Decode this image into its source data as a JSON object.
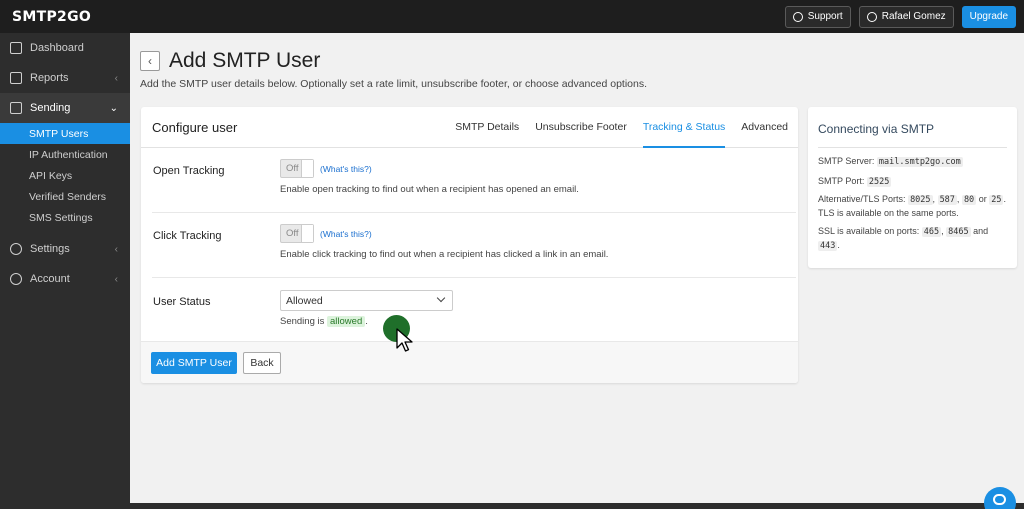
{
  "topbar": {
    "logo": "SMTP2GO",
    "support_label": "Support",
    "user_label": "Rafael Gomez",
    "upgrade_label": "Upgrade"
  },
  "sidebar": {
    "items": [
      {
        "label": "Dashboard",
        "icon": "home-icon"
      },
      {
        "label": "Reports",
        "icon": "document-icon"
      },
      {
        "label": "Sending",
        "icon": "paper-plane-icon"
      },
      {
        "label": "Settings",
        "icon": "gear-icon"
      },
      {
        "label": "Account",
        "icon": "user-circle-icon"
      }
    ],
    "sending_sub": [
      {
        "label": "SMTP Users"
      },
      {
        "label": "IP Authentication"
      },
      {
        "label": "API Keys"
      },
      {
        "label": "Verified Senders"
      },
      {
        "label": "SMS Settings"
      }
    ]
  },
  "header": {
    "title": "Add SMTP User",
    "subtitle": "Add the SMTP user details below. Optionally set a rate limit, unsubscribe footer, or choose advanced options."
  },
  "card": {
    "title": "Configure user",
    "tabs": [
      {
        "label": "SMTP Details"
      },
      {
        "label": "Unsubscribe Footer"
      },
      {
        "label": "Tracking & Status"
      },
      {
        "label": "Advanced"
      }
    ],
    "open_tracking": {
      "label": "Open Tracking",
      "toggle": "Off",
      "whats": "(What's this?)",
      "help": "Enable open tracking to find out when a recipient has opened an email."
    },
    "click_tracking": {
      "label": "Click Tracking",
      "toggle": "Off",
      "whats": "(What's this?)",
      "help": "Enable click tracking to find out when a recipient has clicked a link in an email."
    },
    "user_status": {
      "label": "User Status",
      "value": "Allowed",
      "status_prefix": "Sending is",
      "status_value": "allowed",
      "status_suffix": "."
    },
    "add_button": "Add SMTP User",
    "back_button": "Back"
  },
  "side": {
    "title": "Connecting via SMTP",
    "server_label": "SMTP Server:",
    "server": "mail.smtp2go.com",
    "port_label": "SMTP Port:",
    "port": "2525",
    "alt_label": "Alternative/TLS Ports:",
    "alt_ports": [
      "8025",
      "587",
      "80"
    ],
    "alt_or": "or",
    "alt_last": "25",
    "alt_note": "TLS is available on the same ports.",
    "ssl_label": "SSL is available on ports:",
    "ssl_ports": [
      "465",
      "8465"
    ],
    "ssl_and": "and",
    "ssl_last": "443"
  },
  "colors": {
    "accent": "#1a8fe3",
    "sidebar_bg": "#2d2d2d",
    "topbar_bg": "#1e1e1e",
    "allowed_badge_bg": "#dcf3dc"
  }
}
